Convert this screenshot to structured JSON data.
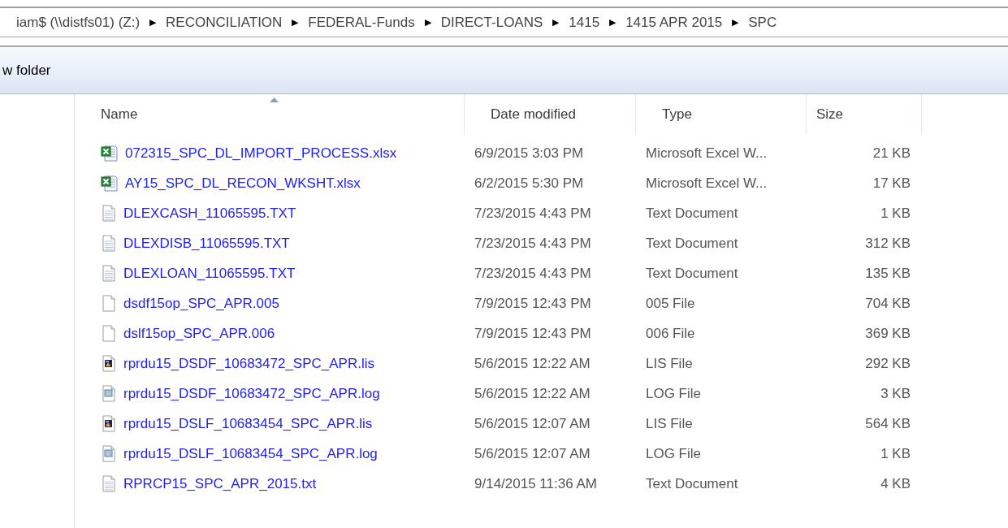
{
  "breadcrumb": {
    "root": "iam$ (\\\\distfs01) (Z:)",
    "separator": "▶",
    "segments": [
      "RECONCILIATION",
      "FEDERAL-Funds",
      "DIRECT-LOANS",
      "1415",
      "1415 APR 2015",
      "SPC"
    ]
  },
  "toolbar": {
    "button": "w folder"
  },
  "table": {
    "columns": [
      {
        "label": "Name",
        "sorted": true
      },
      {
        "label": "Date modified",
        "sorted": false
      },
      {
        "label": "Type",
        "sorted": false
      },
      {
        "label": "Size",
        "sorted": false
      }
    ],
    "rows": [
      {
        "kind": "excel",
        "name": "072315_SPC_DL_IMPORT_PROCESS.xlsx",
        "date": "6/9/2015 3:03 PM",
        "type": "Microsoft Excel W...",
        "size": "21 KB"
      },
      {
        "kind": "excel",
        "name": "AY15_SPC_DL_RECON_WKSHT.xlsx",
        "date": "6/2/2015 5:30 PM",
        "type": "Microsoft Excel W...",
        "size": "17 KB"
      },
      {
        "kind": "text",
        "name": "DLEXCASH_11065595.TXT",
        "date": "7/23/2015 4:43 PM",
        "type": "Text Document",
        "size": "1 KB"
      },
      {
        "kind": "text",
        "name": "DLEXDISB_11065595.TXT",
        "date": "7/23/2015 4:43 PM",
        "type": "Text Document",
        "size": "312 KB"
      },
      {
        "kind": "text",
        "name": "DLEXLOAN_11065595.TXT",
        "date": "7/23/2015 4:43 PM",
        "type": "Text Document",
        "size": "135 KB"
      },
      {
        "kind": "blank",
        "name": "dsdf15op_SPC_APR.005",
        "date": "7/9/2015 12:43 PM",
        "type": "005 File",
        "size": "704 KB"
      },
      {
        "kind": "blank",
        "name": "dslf15op_SPC_APR.006",
        "date": "7/9/2015 12:43 PM",
        "type": "006 File",
        "size": "369 KB"
      },
      {
        "kind": "lis",
        "name": "rprdu15_DSDF_10683472_SPC_APR.lis",
        "date": "5/6/2015 12:22 AM",
        "type": "LIS File",
        "size": "292 KB"
      },
      {
        "kind": "log",
        "name": "rprdu15_DSDF_10683472_SPC_APR.log",
        "date": "5/6/2015 12:22 AM",
        "type": "LOG File",
        "size": "3 KB"
      },
      {
        "kind": "lis",
        "name": "rprdu15_DSLF_10683454_SPC_APR.lis",
        "date": "5/6/2015 12:07 AM",
        "type": "LIS File",
        "size": "564 KB"
      },
      {
        "kind": "log",
        "name": "rprdu15_DSLF_10683454_SPC_APR.log",
        "date": "5/6/2015 12:07 AM",
        "type": "LOG File",
        "size": "1 KB"
      },
      {
        "kind": "text",
        "name": "RPRCP15_SPC_APR_2015.txt",
        "date": "9/14/2015 11:36 AM",
        "type": "Text Document",
        "size": "4 KB"
      }
    ]
  }
}
